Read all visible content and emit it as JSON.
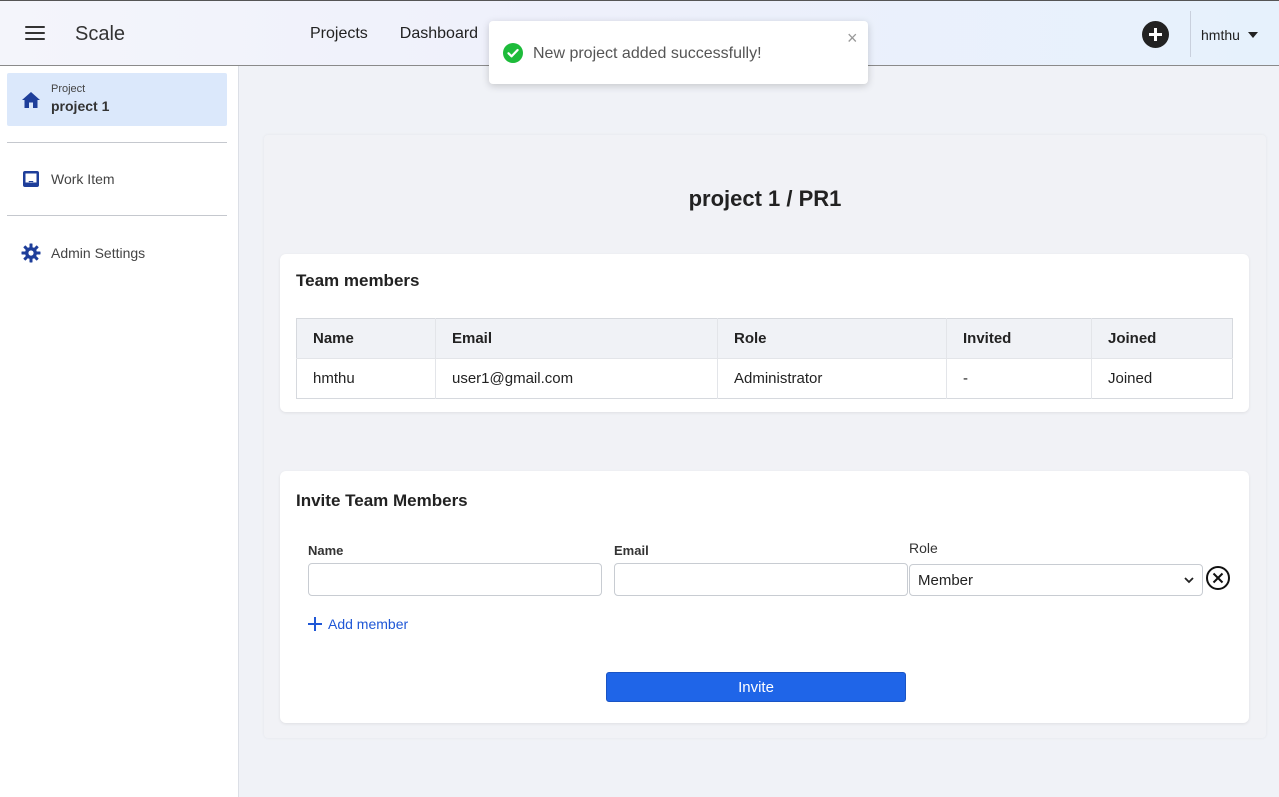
{
  "header": {
    "brand": "Scale",
    "nav": [
      "Projects",
      "Dashboard"
    ],
    "user": "hmthu"
  },
  "sidebar": {
    "project": {
      "caption": "Project",
      "name": "project 1"
    },
    "items": [
      {
        "label": "Work Item",
        "icon": "inbox-icon"
      },
      {
        "label": "Admin Settings",
        "icon": "gear-icon"
      }
    ]
  },
  "main": {
    "title": "project 1 / PR1",
    "team": {
      "title": "Team members",
      "columns": [
        "Name",
        "Email",
        "Role",
        "Invited",
        "Joined"
      ],
      "rows": [
        [
          "hmthu",
          "user1@gmail.com",
          "Administrator",
          "-",
          "Joined"
        ]
      ]
    },
    "invite": {
      "title": "Invite Team Members",
      "name_label": "Name",
      "email_label": "Email",
      "role_label": "Role",
      "name_value": "",
      "email_value": "",
      "role_value": "Member",
      "add_member": "Add member",
      "invite_button": "Invite"
    }
  },
  "toast": {
    "message": "New project added successfully!",
    "close": "×"
  },
  "colors": {
    "accent": "#1f65e8",
    "sidebar_active": "#dbe8fb",
    "success": "#1dbb3a"
  }
}
